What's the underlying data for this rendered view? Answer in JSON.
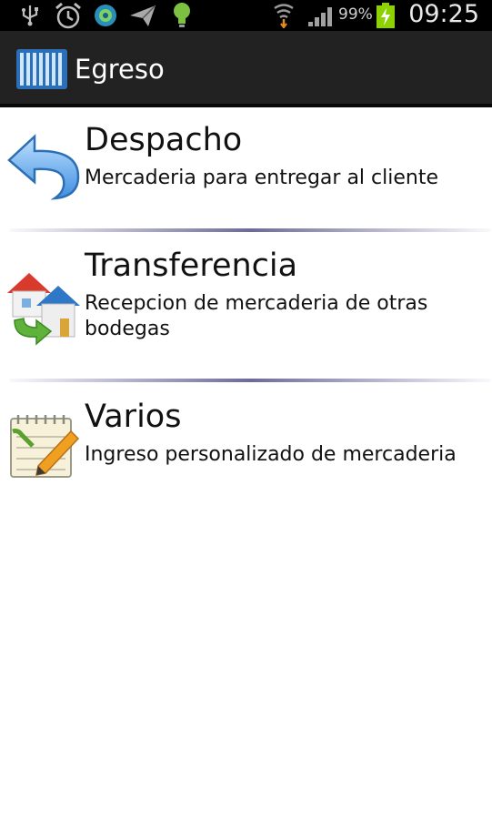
{
  "status_bar": {
    "battery_percent": "99%",
    "time": "09:25",
    "icons": [
      "usb-icon",
      "alarm-icon",
      "sync-app-icon",
      "send-icon",
      "lightbulb-icon",
      "wifi-icon",
      "signal-icon",
      "battery-charging-icon"
    ]
  },
  "action_bar": {
    "title": "Egreso",
    "icon": "barcode-app-icon"
  },
  "items": [
    {
      "title": "Despacho",
      "description": "Mercaderia para entregar al cliente",
      "icon": "return-arrow-icon"
    },
    {
      "title": "Transferencia",
      "description": "Recepcion de mercaderia de otras bodegas",
      "icon": "house-transfer-icon"
    },
    {
      "title": "Varios",
      "description": "Ingreso personalizado de mercaderia",
      "icon": "notepad-pencil-icon"
    }
  ],
  "colors": {
    "status_bar_bg": "#000000",
    "action_bar_bg": "#222222",
    "divider": "#6d6a9a",
    "battery": "#8cd100"
  }
}
